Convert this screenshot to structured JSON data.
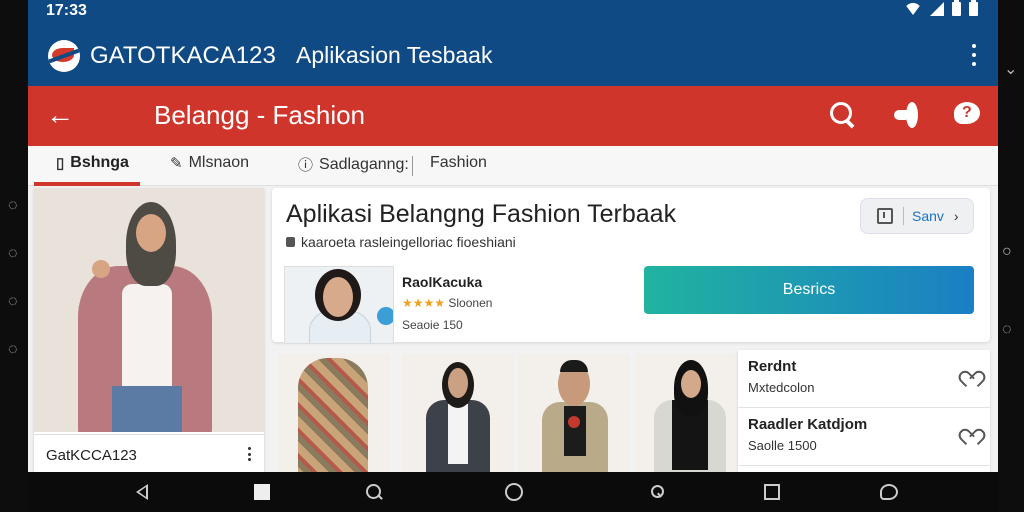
{
  "status": {
    "time": "17:33"
  },
  "app": {
    "name": "GATOTKACA123",
    "tagline": "Aplikasion Tesbaak"
  },
  "toolbar": {
    "title": "Belangg - Fashion"
  },
  "tabs": [
    {
      "label": "Bshnga",
      "icon": "bag-icon"
    },
    {
      "label": "Mlsnaon",
      "icon": "pencil-icon"
    },
    {
      "label": "Sadlaganng:",
      "icon": "info-icon"
    },
    {
      "label": "Fashion",
      "icon": ""
    }
  ],
  "left_card": {
    "caption": "GatKCCA123"
  },
  "main_card": {
    "title": "Aplikasi Belangng Fashion Terbaak",
    "subtitle": "kaaroeta rasleingelloriac fioeshiani",
    "save_label": "Sanv",
    "seller": {
      "name": "RaolKacuka",
      "rating_text": "Sloonen",
      "stars": "★★★★",
      "extra": "Seaoie 150"
    },
    "cta_label": "Besrics"
  },
  "list_items": [
    {
      "title": "Rerdnt",
      "subtitle": "Mxtedcolon"
    },
    {
      "title": "Raadler Katdjom",
      "subtitle": "Saolle 1500"
    }
  ],
  "colors": {
    "app_bar": "#0f4a84",
    "toolbar": "#d0352b",
    "cta_start": "#21b3a0",
    "cta_end": "#1a7fc4"
  }
}
